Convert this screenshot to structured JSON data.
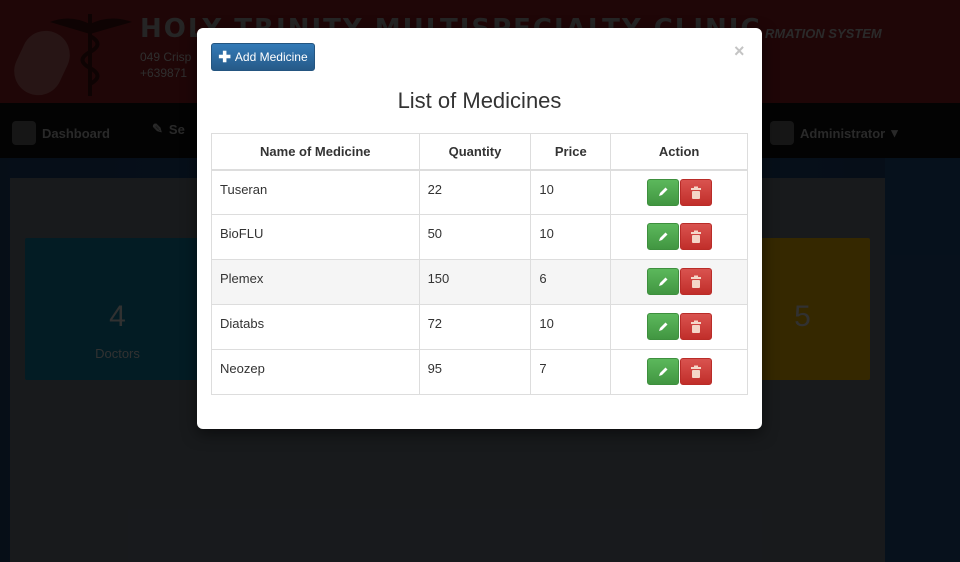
{
  "background": {
    "clinic_name": "HOLY TRINITY MULTISPECIALTY CLINIC",
    "address_partial": "049 Crisp",
    "phone_partial": "+639871",
    "system_name_partial": "RMATION SYSTEM",
    "nav": {
      "dashboard": "Dashboard",
      "second_partial": "Se",
      "user": "Administrator"
    },
    "cards": {
      "doctors": {
        "count": "4",
        "label": "Doctors"
      },
      "medicines": {
        "count": "5"
      }
    }
  },
  "modal": {
    "add_button_label": "Add Medicine",
    "close_label": "×",
    "title": "List of Medicines",
    "table": {
      "headers": [
        "Name of Medicine",
        "Quantity",
        "Price",
        "Action"
      ],
      "rows": [
        {
          "name": "Tuseran",
          "quantity": "22",
          "price": "10"
        },
        {
          "name": "BioFLU",
          "quantity": "50",
          "price": "10"
        },
        {
          "name": "Plemex",
          "quantity": "150",
          "price": "6"
        },
        {
          "name": "Diatabs",
          "quantity": "72",
          "price": "10"
        },
        {
          "name": "Neozep",
          "quantity": "95",
          "price": "7"
        }
      ]
    }
  },
  "colors": {
    "primary": "#337ab7",
    "success": "#5cb85c",
    "danger": "#d9534f"
  }
}
